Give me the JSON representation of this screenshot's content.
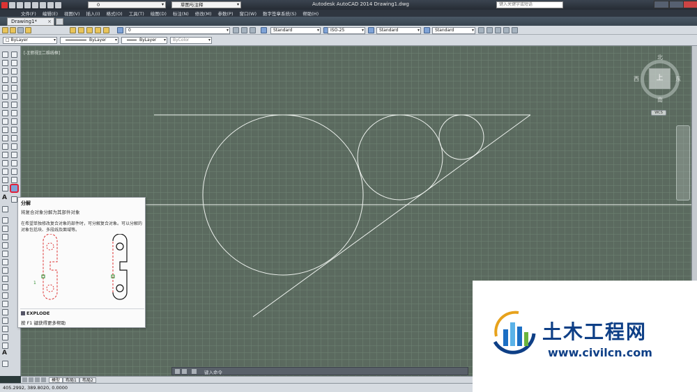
{
  "title_bar": {
    "layer_combo": "0",
    "workspace": "草图与注释",
    "title": "Autodesk AutoCAD 2014    Drawing1.dwg",
    "search_placeholder": "键入关键字或短语"
  },
  "menu": [
    "文件(F)",
    "编辑(E)",
    "视图(V)",
    "插入(I)",
    "格式(O)",
    "工具(T)",
    "绘图(D)",
    "标注(N)",
    "修改(M)",
    "参数(P)",
    "窗口(W)",
    "数字签章系统(S)",
    "帮助(H)"
  ],
  "tabs": {
    "active": "Drawing1*"
  },
  "toolbar1": {
    "layer_value": "0",
    "text_style": "Standard",
    "dim_style": "ISO-25",
    "table_style": "Standard",
    "mleader_style": "Standard"
  },
  "toolbar2": {
    "color": "ByLayer",
    "linetype": "ByLayer",
    "lineweight": "ByLayer",
    "plotstyle": "ByColor"
  },
  "viewport": {
    "label": "[-][俯视][二维线框]",
    "viewcube": {
      "north": "北",
      "south": "南",
      "east": "东",
      "west": "西",
      "top": "上",
      "wcs": "WCS"
    }
  },
  "tooltip": {
    "title": "分解",
    "description": "将复合对象分解为其部件对象",
    "body": "在希望单独修改复合对象的部件时，可分解复合对象。可以分解的对象包括块、多段线及面域等。",
    "diagram_marker": "1",
    "command": "EXPLODE",
    "help": "按 F1 键获得更多帮助"
  },
  "command_line": {
    "placeholder": "键入命令"
  },
  "layout_tabs": [
    "模型",
    "布局1",
    "布局2"
  ],
  "status": {
    "coordinates": "405.2992,  389.8020, 0.0000"
  },
  "watermark": {
    "name": "土木工程网",
    "url": "www.civilcn.com"
  },
  "colors": {
    "canvas": "#5b6a5f",
    "highlight": "#e0203a",
    "watermark_blue": "#0e3f86"
  }
}
